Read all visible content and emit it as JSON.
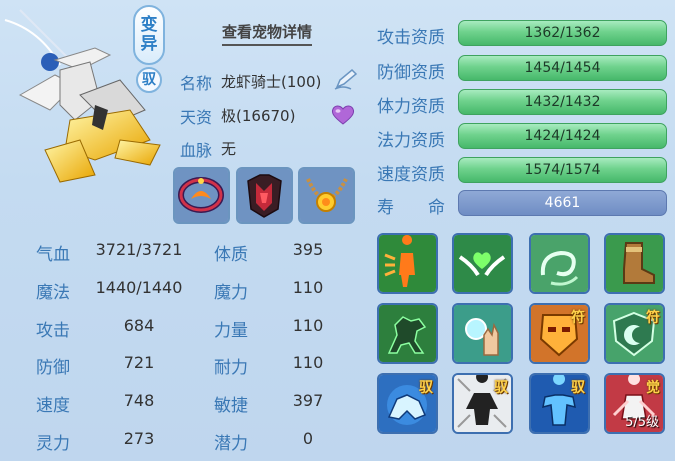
{
  "pet": {
    "variant_badge": [
      "变",
      "异"
    ],
    "ride_badge": "驭",
    "detail_link": "查看宠物详情",
    "name_label": "名称",
    "name_value": "龙虾骑士(100)",
    "aptitude_label": "天资",
    "aptitude_value": "极(16670)",
    "bloodline_label": "血脉",
    "bloodline_value": "无"
  },
  "equipment": [
    {
      "icon": "flame-ring-icon"
    },
    {
      "icon": "red-armor-icon"
    },
    {
      "icon": "sun-necklace-icon"
    }
  ],
  "stats": [
    {
      "label": "气血",
      "value": "3721/3721",
      "label2": "体质",
      "value2": "395"
    },
    {
      "label": "魔法",
      "value": "1440/1440",
      "label2": "魔力",
      "value2": "110"
    },
    {
      "label": "攻击",
      "value": "684",
      "label2": "力量",
      "value2": "110"
    },
    {
      "label": "防御",
      "value": "721",
      "label2": "耐力",
      "value2": "110"
    },
    {
      "label": "速度",
      "value": "748",
      "label2": "敏捷",
      "value2": "397"
    },
    {
      "label": "灵力",
      "value": "273",
      "label2": "潜力",
      "value2": "0"
    }
  ],
  "aptitudes": [
    {
      "label": "攻击资质",
      "value": "1362/1362",
      "fill": 1.0
    },
    {
      "label": "防御资质",
      "value": "1454/1454",
      "fill": 1.0
    },
    {
      "label": "体力资质",
      "value": "1432/1432",
      "fill": 1.0
    },
    {
      "label": "法力资质",
      "value": "1424/1424",
      "fill": 1.0
    },
    {
      "label": "速度资质",
      "value": "1574/1574",
      "fill": 1.0
    }
  ],
  "life": {
    "label_a": "寿",
    "label_b": "命",
    "value": "4661"
  },
  "skills": [
    {
      "icon": "strike-figure-icon",
      "tag": ""
    },
    {
      "icon": "winged-heart-icon",
      "tag": ""
    },
    {
      "icon": "green-swirl-icon",
      "tag": ""
    },
    {
      "icon": "boot-icon",
      "tag": ""
    },
    {
      "icon": "horse-icon",
      "tag": ""
    },
    {
      "icon": "palm-orb-icon",
      "tag": ""
    },
    {
      "icon": "mask-icon",
      "tag": "符"
    },
    {
      "icon": "shield-moon-icon",
      "tag": "符"
    },
    {
      "icon": "blue-beast-icon",
      "tag": "驭"
    },
    {
      "icon": "dark-figure-icon",
      "tag": "驭"
    },
    {
      "icon": "muscle-figure-icon",
      "tag": "驭"
    },
    {
      "icon": "red-warrior-icon",
      "tag": "觉",
      "level": "5/5级"
    }
  ]
}
